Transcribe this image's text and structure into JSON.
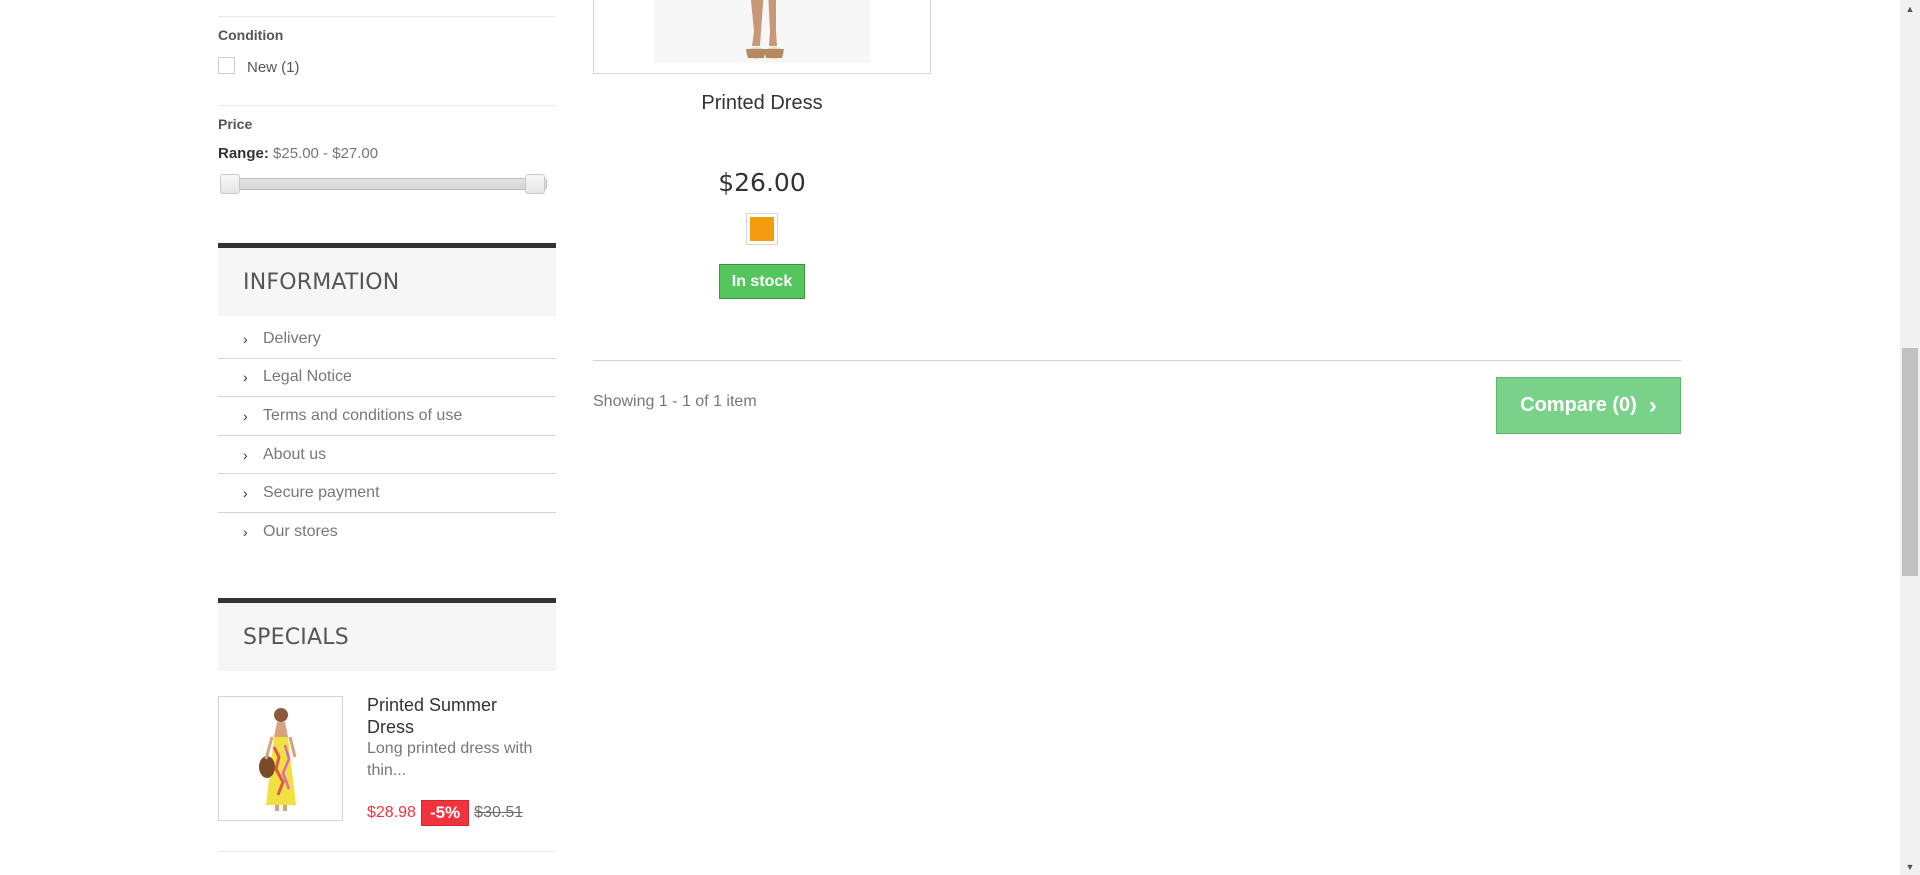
{
  "filters": {
    "condition": {
      "title": "Condition",
      "options": [
        {
          "label": "New (1)",
          "checked": false
        }
      ]
    },
    "price": {
      "title": "Price",
      "range_key": "Range:",
      "range_value": "$25.00 - $27.00",
      "slider_min": 25.0,
      "slider_max": 27.0
    }
  },
  "information": {
    "title": "INFORMATION",
    "items": [
      {
        "label": "Delivery"
      },
      {
        "label": "Legal Notice"
      },
      {
        "label": "Terms and conditions of use"
      },
      {
        "label": "About us"
      },
      {
        "label": "Secure payment"
      },
      {
        "label": "Our stores"
      }
    ]
  },
  "specials": {
    "title": "SPECIALS",
    "product": {
      "name": "Printed Summer Dress",
      "description": "Long printed dress with thin...",
      "price_new": "$28.98",
      "discount": "-5%",
      "price_old": "$30.51"
    }
  },
  "product": {
    "name": "Printed Dress",
    "price": "$26.00",
    "color": "#f39c11",
    "availability": "In stock"
  },
  "listing": {
    "showing": "Showing 1 - 1 of 1 item",
    "compare_label": "Compare (0)"
  },
  "colors": {
    "stock_green": "#55c65e",
    "compare_green": "#7ad18a",
    "special_red": "#f13340"
  }
}
